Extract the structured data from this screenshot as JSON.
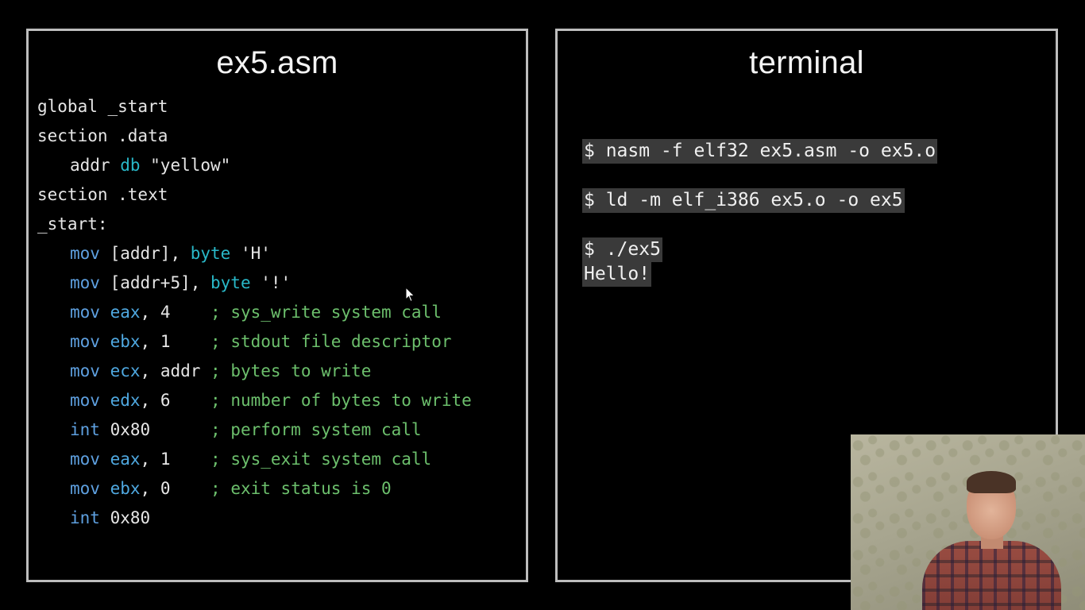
{
  "code_panel": {
    "title": "ex5.asm",
    "lines": [
      {
        "indent": false,
        "tokens": [
          {
            "t": "global _start",
            "c": "pl"
          }
        ]
      },
      {
        "indent": false,
        "tokens": [
          {
            "t": "section .data",
            "c": "pl"
          }
        ]
      },
      {
        "indent": true,
        "tokens": [
          {
            "t": "addr ",
            "c": "pl"
          },
          {
            "t": "db",
            "c": "ty"
          },
          {
            "t": " \"yellow\"",
            "c": "pl"
          }
        ]
      },
      {
        "indent": false,
        "tokens": [
          {
            "t": "section .text",
            "c": "pl"
          }
        ]
      },
      {
        "indent": false,
        "tokens": [
          {
            "t": "_start:",
            "c": "pl"
          }
        ]
      },
      {
        "indent": true,
        "tokens": [
          {
            "t": "mov",
            "c": "kw"
          },
          {
            "t": " [addr], ",
            "c": "pl"
          },
          {
            "t": "byte",
            "c": "ty"
          },
          {
            "t": " 'H'",
            "c": "pl"
          }
        ]
      },
      {
        "indent": true,
        "tokens": [
          {
            "t": "mov",
            "c": "kw"
          },
          {
            "t": " [addr+5], ",
            "c": "pl"
          },
          {
            "t": "byte",
            "c": "ty"
          },
          {
            "t": " '!'",
            "c": "pl"
          }
        ]
      },
      {
        "indent": true,
        "tokens": [
          {
            "t": "mov",
            "c": "kw"
          },
          {
            "t": " ",
            "c": "pl"
          },
          {
            "t": "eax",
            "c": "reg"
          },
          {
            "t": ", 4    ",
            "c": "pl"
          },
          {
            "t": "; sys_write system call",
            "c": "cm"
          }
        ]
      },
      {
        "indent": true,
        "tokens": [
          {
            "t": "mov",
            "c": "kw"
          },
          {
            "t": " ",
            "c": "pl"
          },
          {
            "t": "ebx",
            "c": "reg"
          },
          {
            "t": ", 1    ",
            "c": "pl"
          },
          {
            "t": "; stdout file descriptor",
            "c": "cm"
          }
        ]
      },
      {
        "indent": true,
        "tokens": [
          {
            "t": "mov",
            "c": "kw"
          },
          {
            "t": " ",
            "c": "pl"
          },
          {
            "t": "ecx",
            "c": "reg"
          },
          {
            "t": ", addr ",
            "c": "pl"
          },
          {
            "t": "; bytes to write",
            "c": "cm"
          }
        ]
      },
      {
        "indent": true,
        "tokens": [
          {
            "t": "mov",
            "c": "kw"
          },
          {
            "t": " ",
            "c": "pl"
          },
          {
            "t": "edx",
            "c": "reg"
          },
          {
            "t": ", 6    ",
            "c": "pl"
          },
          {
            "t": "; number of bytes to write",
            "c": "cm"
          }
        ]
      },
      {
        "indent": true,
        "tokens": [
          {
            "t": "int",
            "c": "kw"
          },
          {
            "t": " 0x80      ",
            "c": "pl"
          },
          {
            "t": "; perform system call",
            "c": "cm"
          }
        ]
      },
      {
        "indent": true,
        "tokens": [
          {
            "t": "mov",
            "c": "kw"
          },
          {
            "t": " ",
            "c": "pl"
          },
          {
            "t": "eax",
            "c": "reg"
          },
          {
            "t": ", 1    ",
            "c": "pl"
          },
          {
            "t": "; sys_exit system call",
            "c": "cm"
          }
        ]
      },
      {
        "indent": true,
        "tokens": [
          {
            "t": "mov",
            "c": "kw"
          },
          {
            "t": " ",
            "c": "pl"
          },
          {
            "t": "ebx",
            "c": "reg"
          },
          {
            "t": ", 0    ",
            "c": "pl"
          },
          {
            "t": "; exit status is 0",
            "c": "cm"
          }
        ]
      },
      {
        "indent": true,
        "tokens": [
          {
            "t": "int",
            "c": "kw"
          },
          {
            "t": " 0x80",
            "c": "pl"
          }
        ]
      }
    ]
  },
  "terminal_panel": {
    "title": "terminal",
    "blocks": [
      [
        "$ nasm -f elf32 ex5.asm -o ex5.o"
      ],
      [
        "$ ld -m elf_i386 ex5.o -o ex5"
      ],
      [
        "$ ./ex5",
        "Hello!"
      ]
    ]
  },
  "colors": {
    "background": "#000000",
    "panel_border": "#bdbdbd",
    "keyword": "#5ea0e0",
    "register": "#4fa8e0",
    "type": "#29b8c8",
    "comment": "#6cbf6c",
    "terminal_highlight": "#3a3a3a"
  },
  "webcam": {
    "icon": "presenter-webcam-feed"
  }
}
